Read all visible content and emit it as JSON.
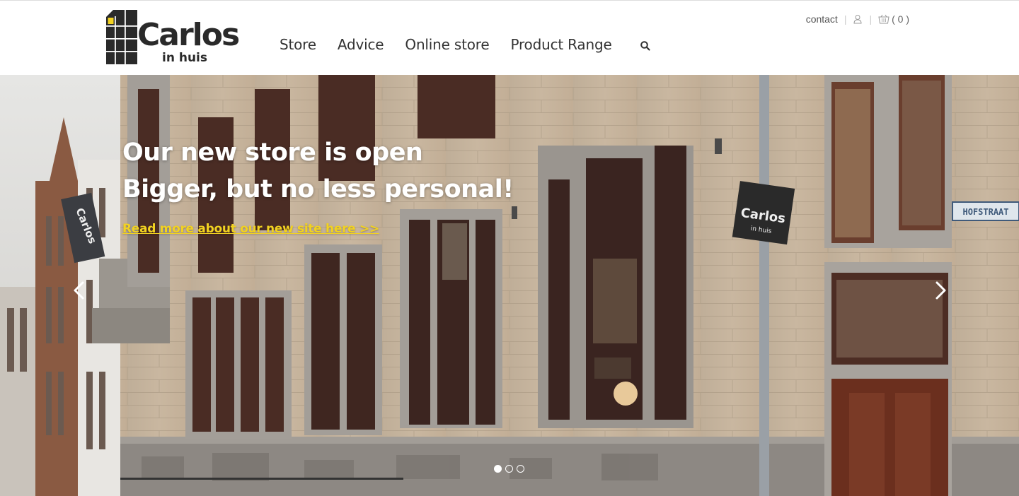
{
  "brand": {
    "name": "Carlos",
    "sub": "in huis"
  },
  "nav": {
    "items": [
      "Store",
      "Advice",
      "Online store",
      "Product Range"
    ]
  },
  "util": {
    "contact": "contact",
    "cart_count": "( 0 )"
  },
  "hero": {
    "headline_1": "Our new store is open",
    "headline_2": "Bigger, but no less personal!",
    "link": "Read more about our new site here >>",
    "street_sign": "HOFSTRAAT",
    "sign_word": "Carlos",
    "sign_sub": "in huis",
    "slides": 3,
    "active_slide": 1
  },
  "colors": {
    "link_yellow": "#f2d221",
    "logo_yellow": "#f2d221",
    "text_dark": "#2a2a2a"
  },
  "icons": [
    "search-icon",
    "user-icon",
    "basket-icon",
    "chevron-left-icon",
    "chevron-right-icon"
  ]
}
